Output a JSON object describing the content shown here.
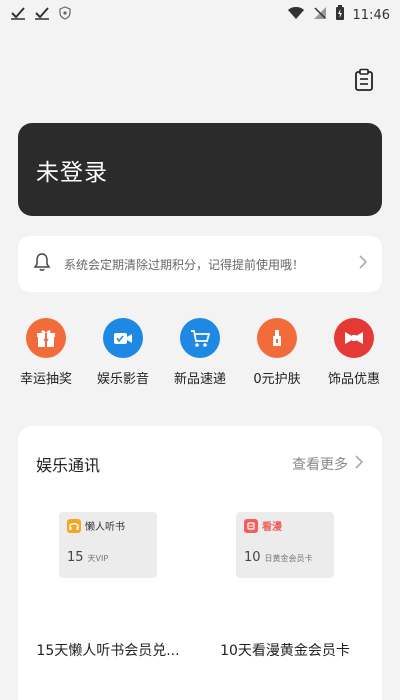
{
  "status_bar": {
    "time": "11:46"
  },
  "login_card": {
    "label": "未登录"
  },
  "notice": {
    "text": "系统会定期清除过期积分，记得提前使用哦！"
  },
  "categories": [
    {
      "label": "幸运抽奖",
      "color": "#f26b3a",
      "icon": "gift-icon"
    },
    {
      "label": "娱乐影音",
      "color": "#1e88e5",
      "icon": "video-icon"
    },
    {
      "label": "新品速递",
      "color": "#1e88e5",
      "icon": "cart-icon"
    },
    {
      "label": "0元护肤",
      "color": "#f26b3a",
      "icon": "lipstick-icon"
    },
    {
      "label": "饰品优惠",
      "color": "#e53935",
      "icon": "bow-icon"
    }
  ],
  "entertainment": {
    "title": "娱乐通讯",
    "more": "查看更多",
    "products": [
      {
        "name": "15天懒人听书会员兑...",
        "brand": "懒人听书",
        "days": "15",
        "unit": "天VIP",
        "brand_color": "#f5a623"
      },
      {
        "name": "10天看漫黄金会员卡",
        "brand": "看漫",
        "days": "10",
        "unit": "日黄金会员卡",
        "brand_color": "#f0605d"
      }
    ]
  }
}
